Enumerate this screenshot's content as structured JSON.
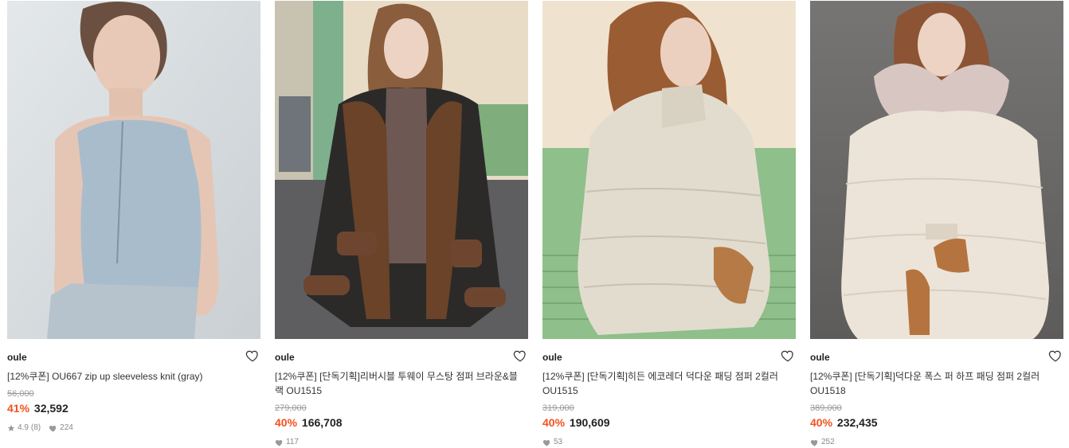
{
  "products": [
    {
      "brand": "oule",
      "title": "[12%쿠폰] OU667 zip up sleeveless knit (gray)",
      "original_price": "56,000",
      "discount": "41%",
      "price": "32,592",
      "rating": "4.9",
      "reviews": "(8)",
      "likes": "224"
    },
    {
      "brand": "oule",
      "title": "[12%쿠폰] [단독기획]리버시블 투웨이 무스탕 점퍼 브라운&블랙 OU1515",
      "original_price": "279,000",
      "discount": "40%",
      "price": "166,708",
      "likes": "117"
    },
    {
      "brand": "oule",
      "title": "[12%쿠폰] [단독기획]히든 에코레더 덕다운 패딩 점퍼 2컬러 OU1515",
      "original_price": "319,000",
      "discount": "40%",
      "price": "190,609",
      "likes": "53"
    },
    {
      "brand": "oule",
      "title": "[12%쿠폰] [단독기획]덕다운 폭스 퍼 하프 패딩 점퍼 2컬러 OU1518",
      "original_price": "389,000",
      "discount": "40%",
      "price": "232,435",
      "likes": "252"
    }
  ],
  "icons": {
    "wishlist": "heart-outline-icon",
    "rating": "star-icon",
    "likes": "heart-filled-icon"
  },
  "colors": {
    "discount": "#f4511e",
    "price": "#222222",
    "original_price": "#9a9a9a",
    "meta": "#888888"
  }
}
